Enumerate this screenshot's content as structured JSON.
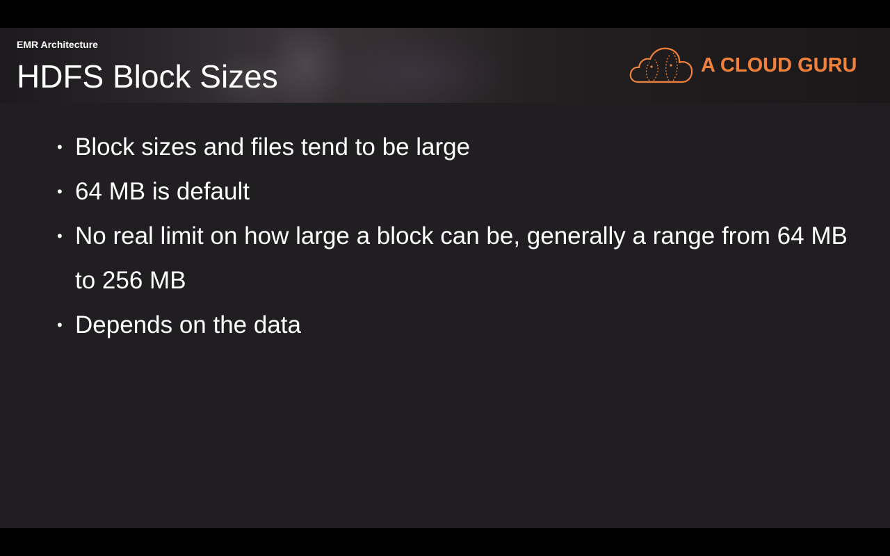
{
  "header": {
    "section_label": "EMR Architecture",
    "title": "HDFS Block Sizes",
    "brand_text": "A CLOUD GURU",
    "brand_icon": "cloud-logo-icon",
    "brand_color": "#f0813c"
  },
  "bullets": [
    {
      "text": "Block sizes and files tend to be large"
    },
    {
      "text": "64 MB is default"
    },
    {
      "text": "No real limit on how large a block can be, generally a range from 64 MB to 256 MB"
    },
    {
      "text": "Depends on the data"
    }
  ],
  "colors": {
    "background": "#201e21",
    "text": "#ffffff",
    "letterbox": "#000000"
  }
}
